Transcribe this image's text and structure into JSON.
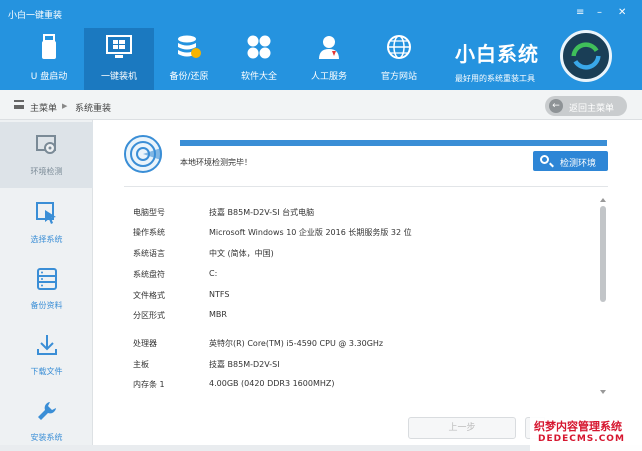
{
  "window": {
    "title": "小白一键重装",
    "menu_glyph": "≡",
    "minimize_glyph": "–",
    "close_glyph": "✕"
  },
  "toolbar": {
    "items": [
      {
        "label": "U 盘启动",
        "icon": "usb-drive-icon",
        "active": false
      },
      {
        "label": "一键装机",
        "icon": "windows-install-icon",
        "active": true
      },
      {
        "label": "备份/还原",
        "icon": "backup-database-icon",
        "active": false
      },
      {
        "label": "软件大全",
        "icon": "apps-grid-icon",
        "active": false
      },
      {
        "label": "人工服务",
        "icon": "support-person-icon",
        "active": false
      },
      {
        "label": "官方网站",
        "icon": "globe-icon",
        "active": false
      }
    ]
  },
  "brand": {
    "name": "小白系统",
    "slogan": "最好用的系统重装工具"
  },
  "breadcrumb": {
    "root": "主菜单",
    "separator": "▶",
    "current": "系统重装"
  },
  "back_button": {
    "label": "返回主菜单",
    "arrow": "←"
  },
  "sidebar": {
    "items": [
      {
        "label": "环境检测",
        "icon": "environment-check-icon",
        "active": true
      },
      {
        "label": "选择系统",
        "icon": "select-system-icon",
        "active": false
      },
      {
        "label": "备份资料",
        "icon": "backup-data-icon",
        "active": false
      },
      {
        "label": "下载文件",
        "icon": "download-icon",
        "active": false
      },
      {
        "label": "安装系统",
        "icon": "install-wrench-icon",
        "active": false
      }
    ]
  },
  "scan": {
    "progress": 1.0,
    "status": "本地环境检测完毕！",
    "detect_button": "检测环境"
  },
  "system_info": [
    {
      "key": "电脑型号",
      "value": "技嘉 B85M-D2V-SI 台式电脑"
    },
    {
      "key": "操作系统",
      "value": "Microsoft Windows 10 企业版 2016 长期服务版 32 位"
    },
    {
      "key": "系统语言",
      "value": "中文 (简体，中国)"
    },
    {
      "key": "系统盘符",
      "value": "C:"
    },
    {
      "key": "文件格式",
      "value": "NTFS"
    },
    {
      "key": "分区形式",
      "value": "MBR"
    },
    {
      "key": "处理器",
      "value": "英特尔(R) Core(TM) i5-4590 CPU @ 3.30GHz"
    },
    {
      "key": "主板",
      "value": "技嘉 B85M-D2V-SI"
    },
    {
      "key": "内存条 1",
      "value": "4.00GB (0420 DDR3 1600MHZ)"
    }
  ],
  "footer": {
    "prev_button": "上一步"
  },
  "watermark": {
    "line1": "织梦内容管理系统",
    "line2": "DEDECMS.COM"
  },
  "colors": {
    "primary": "#2593df",
    "active_nav": "#1b79c0",
    "accent": "#3a8ed6",
    "watermark": "#d6162f"
  }
}
